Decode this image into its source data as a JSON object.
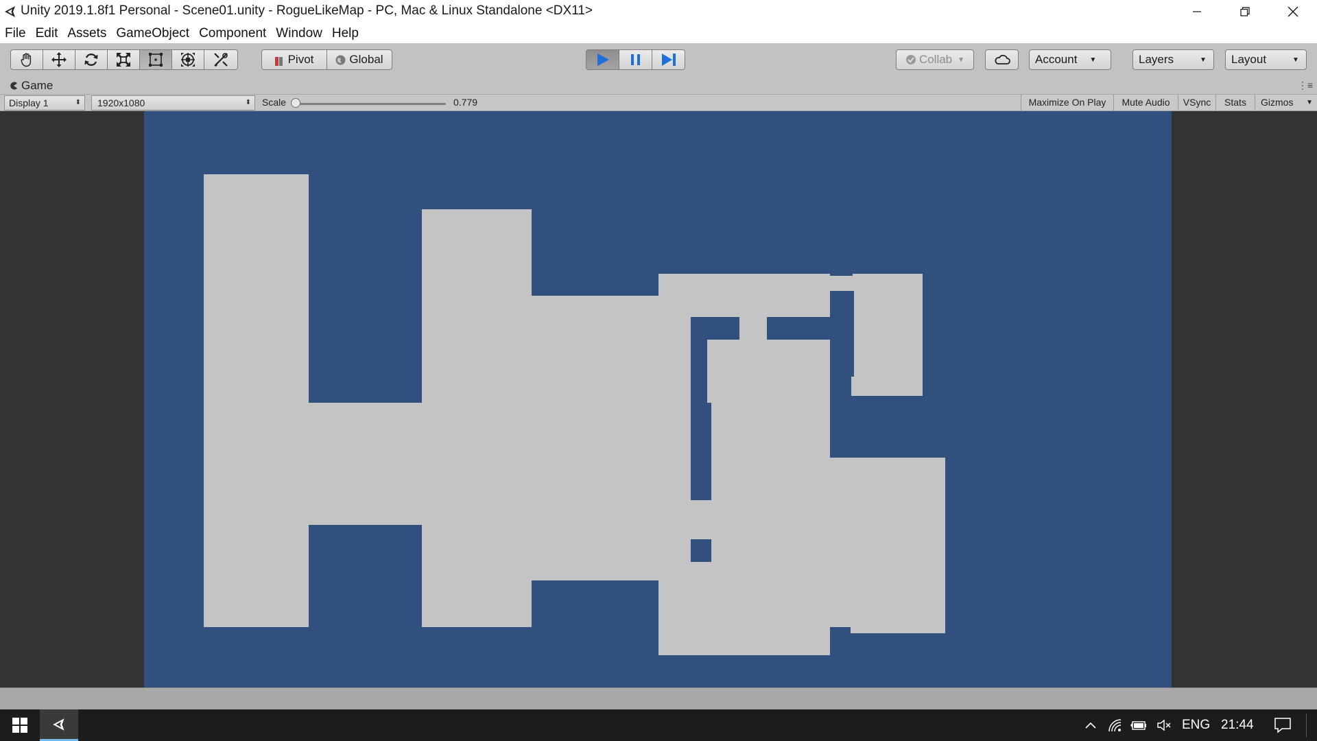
{
  "window": {
    "title": "Unity 2019.1.8f1 Personal - Scene01.unity - RogueLikeMap - PC, Mac & Linux Standalone <DX11>",
    "icon": "unity-logo-icon",
    "controls": [
      "minimize-icon",
      "restore-icon",
      "close-icon"
    ]
  },
  "menu": [
    "File",
    "Edit",
    "Assets",
    "GameObject",
    "Component",
    "Window",
    "Help"
  ],
  "toolbar": {
    "tools": [
      "hand-tool-icon",
      "move-tool-icon",
      "rotate-tool-icon",
      "scale-tool-icon",
      "rect-tool-icon",
      "transform-tool-icon",
      "custom-tool-icon"
    ],
    "active_tool": "rect-tool-icon",
    "pivot_label": "Pivot",
    "global_label": "Global",
    "play_icons": [
      "play-icon",
      "pause-icon",
      "step-icon"
    ],
    "play_active": true,
    "collab_label": "Collab",
    "account_label": "Account",
    "layers_label": "Layers",
    "layout_label": "Layout",
    "accent_color": "#1e6fd9"
  },
  "game_view": {
    "tab_label": "Game",
    "display": "Display 1",
    "resolution": "1920x1080",
    "scale_label": "Scale",
    "scale_value": "0.779",
    "scale_fraction": 0.02,
    "buttons": [
      "Maximize On Play",
      "Mute Audio",
      "VSync",
      "Stats",
      "Gizmos"
    ],
    "background_color": "#32507e",
    "floor_color": "#c4c4c4"
  },
  "taskbar": {
    "apps": [
      "windows-start-icon",
      "unity-app-icon"
    ],
    "tray_icons": [
      "chevron-up-icon",
      "wifi-icon",
      "battery-icon",
      "speaker-muted-icon"
    ],
    "language": "ENG",
    "time": "21:44",
    "notification_icon": "notification-icon"
  }
}
